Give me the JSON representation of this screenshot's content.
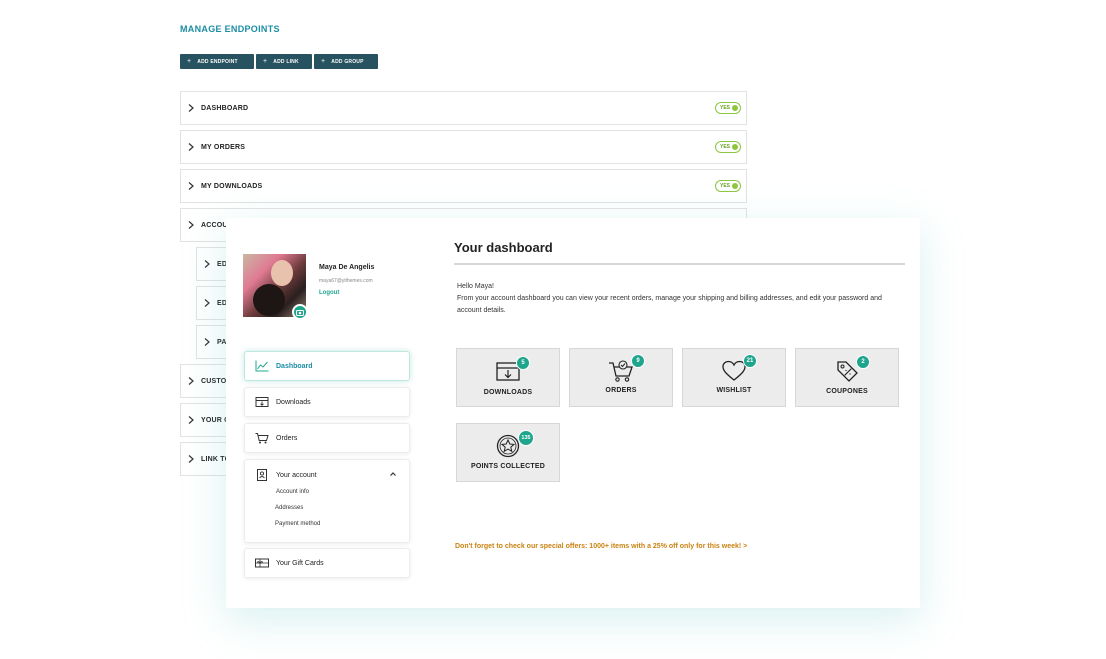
{
  "manage": {
    "title": "MANAGE ENDPOINTS",
    "buttons": [
      "ADD ENDPOINT",
      "ADD LINK",
      "ADD GROUP"
    ]
  },
  "endpoints": [
    {
      "label": "DASHBOARD",
      "toggle": "YES"
    },
    {
      "label": "MY ORDERS",
      "toggle": "YES"
    },
    {
      "label": "MY DOWNLOADS",
      "toggle": "YES"
    },
    {
      "label": "ACCOU"
    },
    {
      "label": "ED"
    },
    {
      "label": "ED"
    },
    {
      "label": "PA"
    },
    {
      "label": "CUSTO"
    },
    {
      "label": "YOUR C"
    },
    {
      "label": "LINK TO"
    }
  ],
  "user": {
    "name": "Maya De Angelis",
    "email": "maya67@yithemes.com",
    "logout": "Logout"
  },
  "nav": {
    "dashboard": "Dashboard",
    "downloads": "Downloads",
    "orders": "Orders",
    "account": "Your account",
    "account_info": "Account info",
    "addresses": "Addresses",
    "payment": "Payment method",
    "gift_cards": "Your Gift Cards"
  },
  "dashboard": {
    "title": "Your dashboard",
    "hello": "Hello Maya!",
    "intro": "From your account dashboard you can view your recent orders, manage your shipping and billing addresses, and edit your password and account details.",
    "tiles": [
      {
        "label": "DOWNLOADS",
        "count": "5",
        "icon": "download-box-icon"
      },
      {
        "label": "ORDERS",
        "count": "9",
        "icon": "cart-icon"
      },
      {
        "label": "WISHLIST",
        "count": "21",
        "icon": "heart-icon"
      },
      {
        "label": "COUPONES",
        "count": "2",
        "icon": "tag-icon"
      },
      {
        "label": "POINTS COLLECTED",
        "count": "135",
        "icon": "star-badge-icon"
      }
    ],
    "offer": "Don't forget to check our special offers: 1000+ items with a 25% off only for this week! >"
  },
  "colors": {
    "accent": "#1fa58e",
    "title_blue": "#1b8ea5",
    "button_bg": "#27525f",
    "toggle_green": "#8dc63f",
    "offer_orange": "#c98211"
  }
}
